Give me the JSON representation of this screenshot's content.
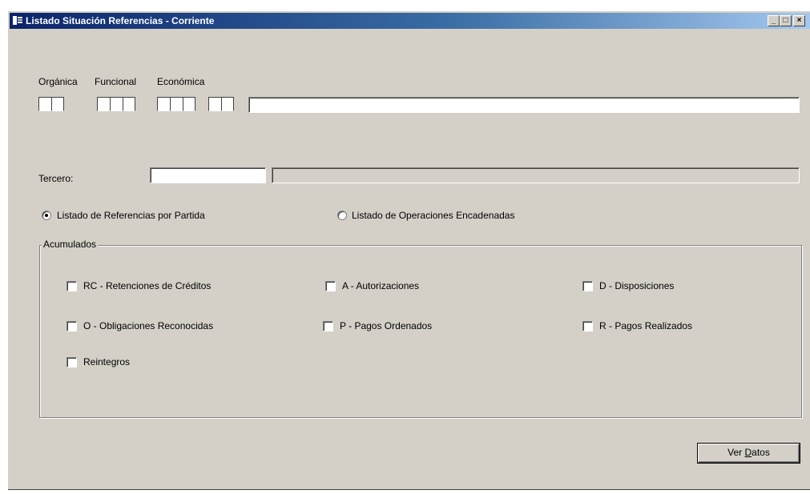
{
  "window": {
    "title": "Listado Situación Referencias - Corriente",
    "controls": [
      "_",
      "□",
      "×"
    ]
  },
  "clasificacion": {
    "organica_label": "Orgánica",
    "funcional_label": "Funcional",
    "economica_label": "Económica",
    "description_value": ""
  },
  "tercero": {
    "label": "Tercero:",
    "code_value": "",
    "name_value": ""
  },
  "listado_options": [
    {
      "label": "Listado de Referencias por Partida",
      "selected": true
    },
    {
      "label": "Listado de Operaciones Encadenadas",
      "selected": false
    }
  ],
  "acumulados": {
    "title": "Acumulados",
    "items": [
      {
        "label": "RC - Retenciones de Créditos",
        "checked": false
      },
      {
        "label": "A - Autorizaciones",
        "checked": false
      },
      {
        "label": "D - Disposiciones",
        "checked": false
      },
      {
        "label": "O - Obligaciones Reconocidas",
        "checked": false
      },
      {
        "label": "P - Pagos Ordenados",
        "checked": false
      },
      {
        "label": "R - Pagos Realizados",
        "checked": false
      },
      {
        "label": "Reintegros",
        "checked": false
      }
    ]
  },
  "ver_datos_button": {
    "prefix": "Ver ",
    "accel": "D",
    "suffix": "atos"
  }
}
